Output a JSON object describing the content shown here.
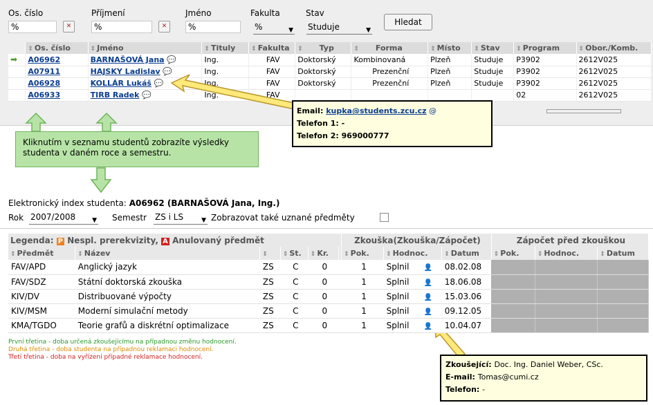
{
  "filters": {
    "os_cislo_label": "Os. číslo",
    "os_cislo_value": "%",
    "prijmeni_label": "Příjmení",
    "prijmeni_value": "%",
    "jmeno_label": "Jméno",
    "jmeno_value": "%",
    "fakulta_label": "Fakulta",
    "fakulta_value": "%",
    "stav_label": "Stav",
    "stav_value": "Studuje",
    "search_button": "Hledat"
  },
  "students": {
    "headers": [
      "Os. číslo",
      "Jméno",
      "Tituly",
      "Fakulta",
      "",
      "Typ",
      "",
      "Forma",
      "Místo",
      "Stav",
      "Program",
      "Obor./Komb."
    ],
    "rows": [
      {
        "id": "A06962",
        "name": "BARNAŠOVÁ Jana",
        "titul": "Ing.",
        "fak": "FAV",
        "typ": "Doktorský",
        "forma": "Kombinovaná",
        "misto": "Plzeň",
        "stav": "Studuje",
        "program": "P3902",
        "obor": "2612V025"
      },
      {
        "id": "A07911",
        "name": "HAJSKY Ladislav",
        "titul": "Ing.",
        "fak": "FAV",
        "typ": "Doktorský",
        "forma": "Prezenční",
        "misto": "Plzeň",
        "stav": "Studuje",
        "program": "P3902",
        "obor": "2612V025"
      },
      {
        "id": "A06928",
        "name": "KOLLÁR Lukáš",
        "titul": "Ing.",
        "fak": "FAV",
        "typ": "Doktorský",
        "forma": "Prezenční",
        "misto": "Plzeň",
        "stav": "Studuje",
        "program": "P3902",
        "obor": "2612V025"
      },
      {
        "id": "A06933",
        "name": "TIRB Radek",
        "titul": "Ing.",
        "fak": "FAV",
        "typ": "",
        "forma": "",
        "misto": "",
        "stav": "",
        "program": "02",
        "obor": "2612V025"
      }
    ]
  },
  "contact_popup": {
    "email_label": "Email:",
    "email_value": "kupka@students.zcu.cz",
    "tel1_label": "Telefon 1:",
    "tel1_value": "-",
    "tel2_label": "Telefon 2:",
    "tel2_value": "969000777"
  },
  "hint_text": "Kliknutím v seznamu studentů zobrazíte výsledky studenta v daném roce a semestru.",
  "index": {
    "title_prefix": "Elektronický index studenta:",
    "title_value": "A06962 (BARNAŠOVÁ Jana, Ing.)",
    "rok_label": "Rok",
    "rok_value": "2007/2008",
    "semestr_label": "Semestr",
    "semestr_value": "ZS i LS",
    "uznane_label": "Zobrazovat také uznané předměty"
  },
  "legend": {
    "label": "Legenda:",
    "p_badge": "P",
    "p_text": "Nespl. prerekvizity,",
    "a_badge": "A",
    "a_text": "Anulovaný předmět",
    "zkouska_group": "Zkouška(Zkouška/Zápočet)",
    "zapocet_group": "Zápočet před zkouškou"
  },
  "grades": {
    "headers": [
      "Předmět",
      "Název",
      "",
      "St.",
      "Kr.",
      "Pok.",
      "Hodnoc.",
      "Datum",
      "Pok.",
      "Hodnoc.",
      "Datum"
    ],
    "rows": [
      {
        "kod": "FAV/APD",
        "nazev": "Anglický jazyk",
        "sem": "ZS",
        "st": "C",
        "kr": "0",
        "pok": "1",
        "hod": "Splnil",
        "datum": "08.02.08"
      },
      {
        "kod": "FAV/SDZ",
        "nazev": "Státní doktorská zkouška",
        "sem": "ZS",
        "st": "C",
        "kr": "0",
        "pok": "1",
        "hod": "Splnil",
        "datum": "18.06.08"
      },
      {
        "kod": "KIV/DV",
        "nazev": "Distribuované výpočty",
        "sem": "ZS",
        "st": "C",
        "kr": "0",
        "pok": "1",
        "hod": "Splnil",
        "datum": "15.03.06"
      },
      {
        "kod": "KIV/MSM",
        "nazev": "Moderní simulační metody",
        "sem": "ZS",
        "st": "C",
        "kr": "0",
        "pok": "1",
        "hod": "Splnil",
        "datum": "09.12.05"
      },
      {
        "kod": "KMA/TGDO",
        "nazev": "Teorie grafů a diskrétní optimalizace",
        "sem": "ZS",
        "st": "C",
        "kr": "0",
        "pok": "1",
        "hod": "Splnil",
        "datum": "10.04.07"
      }
    ]
  },
  "notes": {
    "n1": "První třetina - doba určená zkoušejícímu na případnou změnu hodnocení.",
    "n2": "Druhá třetina - doba studenta na případnou reklamaci hodnocení.",
    "n3": "Třetí třetina - doba na vyřízení případné reklamace hodnocení."
  },
  "examiner_popup": {
    "z_label": "Zkoušející:",
    "z_value": "Doc. Ing. Daniel Weber, CSc.",
    "e_label": "E-mail:",
    "e_value": "Tomas@cumi.cz",
    "t_label": "Telefon:",
    "t_value": "-"
  },
  "colors": {
    "note1": "#2a9a2a",
    "note2": "#e08a00",
    "note3": "#d02020",
    "link": "#0a3d91",
    "callout_bg": "#ffffe0",
    "hint_bg": "#b7e4a6"
  }
}
